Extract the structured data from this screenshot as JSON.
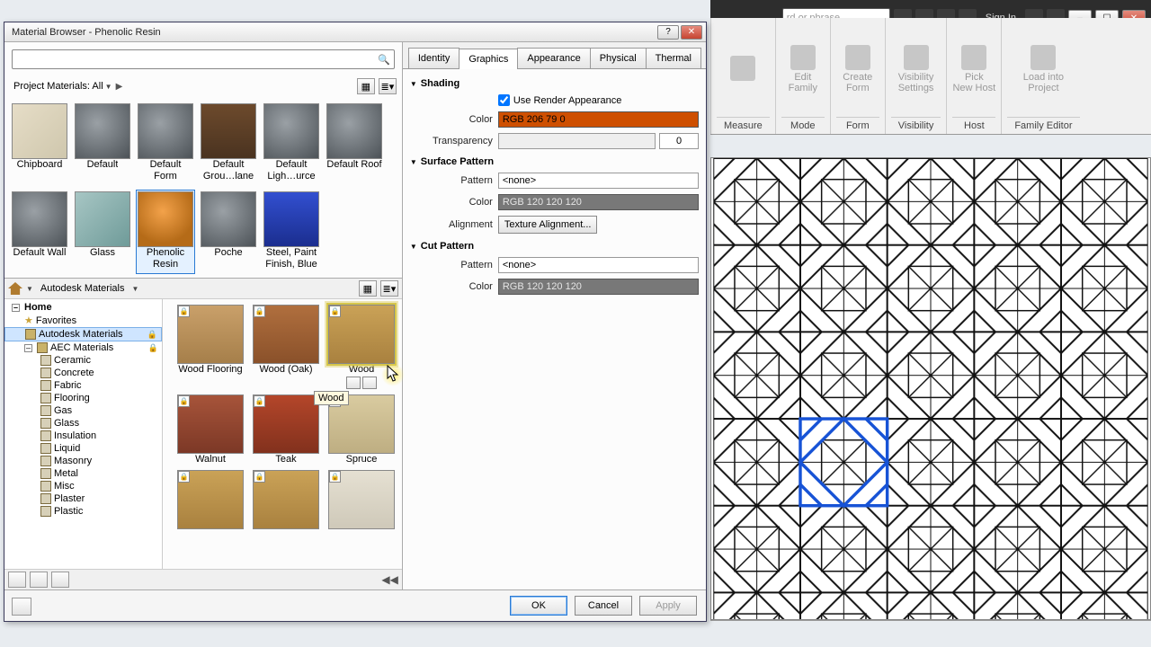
{
  "window": {
    "title": "Material Browser - Phenolic Resin"
  },
  "bg": {
    "search_placeholder": "rd or phrase",
    "signin": "Sign In",
    "groups": [
      {
        "label": "Measure",
        "buttons": [
          {
            "l1": "",
            "l2": ""
          }
        ]
      },
      {
        "label": "Mode",
        "buttons": [
          {
            "l1": "Edit",
            "l2": "Family"
          }
        ]
      },
      {
        "label": "Form",
        "buttons": [
          {
            "l1": "Create",
            "l2": "Form"
          }
        ]
      },
      {
        "label": "Visibility",
        "buttons": [
          {
            "l1": "Visibility",
            "l2": "Settings"
          }
        ]
      },
      {
        "label": "Host",
        "buttons": [
          {
            "l1": "Pick",
            "l2": "New Host"
          }
        ]
      },
      {
        "label": "Family Editor",
        "buttons": [
          {
            "l1": "Load into",
            "l2": "Project"
          }
        ]
      }
    ]
  },
  "filter": {
    "label": "Project Materials: All"
  },
  "project_materials": [
    {
      "name": "Chipboard",
      "bg": "linear-gradient(135deg,#e6ddc7,#cfc7ad)"
    },
    {
      "name": "Default",
      "bg": "radial-gradient(circle at 40% 35%,#9aa0a5,#4c5257)"
    },
    {
      "name": "Default Form",
      "bg": "radial-gradient(circle at 40% 35%,#9aa0a5,#4c5257)"
    },
    {
      "name": "Default Grou…lane",
      "bg": "linear-gradient(#6d4a2c,#4a3320)"
    },
    {
      "name": "Default Ligh…urce",
      "bg": "radial-gradient(circle at 40% 35%,#9aa0a5,#4c5257)"
    },
    {
      "name": "Default Roof",
      "bg": "radial-gradient(circle at 40% 35%,#9aa0a5,#4c5257)"
    },
    {
      "name": "Default Wall",
      "bg": "radial-gradient(circle at 40% 35%,#9aa0a5,#4c5257)"
    },
    {
      "name": "Glass",
      "bg": "linear-gradient(135deg,#a7c6c4,#6f9b99)"
    },
    {
      "name": "Phenolic Resin",
      "bg": "radial-gradient(circle at 45% 35%,#f3a24a,#b56b18 70%)",
      "selected": true
    },
    {
      "name": "Poche",
      "bg": "radial-gradient(circle at 40% 35%,#9aa0a5,#4c5257)"
    },
    {
      "name": "Steel, Paint Finish, Blue",
      "bg": "linear-gradient(#324fd0,#1b2e8f)"
    }
  ],
  "library_header": {
    "label": "Autodesk Materials"
  },
  "tree": {
    "root": "Home",
    "favorites": "Favorites",
    "autodesk": "Autodesk Materials",
    "aec": "AEC Materials",
    "cats": [
      "Ceramic",
      "Concrete",
      "Fabric",
      "Flooring",
      "Gas",
      "Glass",
      "Insulation",
      "Liquid",
      "Masonry",
      "Metal",
      "Misc",
      "Plaster",
      "Plastic"
    ]
  },
  "lib_materials": [
    {
      "name": "Wood Flooring",
      "bg": "linear-gradient(#c9a06a,#a67f4a)"
    },
    {
      "name": "Wood (Oak)",
      "bg": "linear-gradient(#b06f3e,#8a512a)"
    },
    {
      "name": "Wood",
      "bg": "linear-gradient(#caa257,#a9813f)",
      "highlight": true,
      "minibtns": true,
      "tooltip": "Wood"
    },
    {
      "name": "Walnut",
      "bg": "linear-gradient(#a7543a,#7c3826)"
    },
    {
      "name": "Teak",
      "bg": "linear-gradient(#b4462a,#82311d)"
    },
    {
      "name": "Spruce",
      "bg": "linear-gradient(#d9cba0,#beae82)"
    },
    {
      "name": "",
      "bg": "linear-gradient(#caa257,#a9813f)"
    },
    {
      "name": "",
      "bg": "linear-gradient(#caa257,#a9813f)"
    },
    {
      "name": "",
      "bg": "linear-gradient(#e5e0d2,#cfc9b9)"
    }
  ],
  "tabs": [
    "Identity",
    "Graphics",
    "Appearance",
    "Physical",
    "Thermal"
  ],
  "active_tab": "Graphics",
  "props": {
    "shading": "Shading",
    "use_render": "Use Render Appearance",
    "color_label": "Color",
    "shading_color_text": "RGB 206 79 0",
    "shading_color": "#CE4F00",
    "transparency_label": "Transparency",
    "transparency_value": "0",
    "surface": "Surface Pattern",
    "pattern_label": "Pattern",
    "pattern_none": "<none>",
    "sp_color_text": "RGB 120 120 120",
    "alignment_label": "Alignment",
    "alignment_btn": "Texture Alignment...",
    "cut": "Cut Pattern",
    "cp_color_text": "RGB 120 120 120"
  },
  "footer": {
    "ok": "OK",
    "cancel": "Cancel",
    "apply": "Apply"
  }
}
